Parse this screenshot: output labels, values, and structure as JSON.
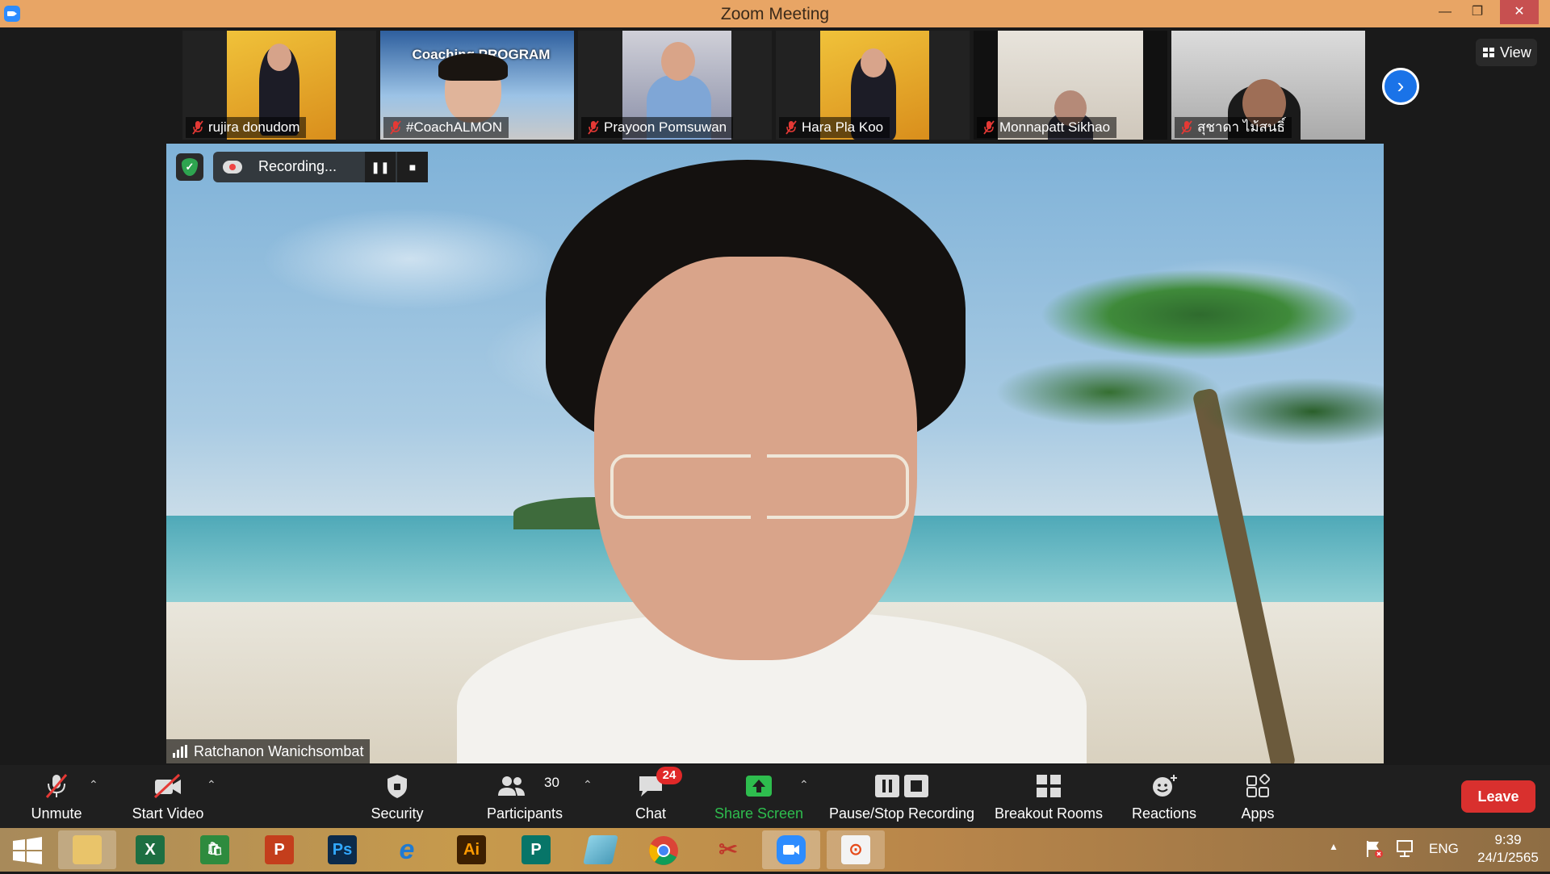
{
  "window": {
    "title": "Zoom Meeting",
    "minimize": "—",
    "maximize": "❐",
    "close": "✕"
  },
  "gallery": {
    "participants": [
      {
        "name": "rujira donudom"
      },
      {
        "name": "#CoachALMON",
        "overlay": "Coaching PROGRAM"
      },
      {
        "name": "Prayoon Pomsuwan"
      },
      {
        "name": "Hara Pla Koo"
      },
      {
        "name": "Monnapatt Sikhao"
      },
      {
        "name": "สุชาดา ไม้สนธิ์"
      }
    ],
    "next_arrow": "›",
    "view_label": "View"
  },
  "recording": {
    "status": "Recording...",
    "pause": "❚❚",
    "stop": "■"
  },
  "active_speaker": {
    "name": "Ratchanon Wanichsombat"
  },
  "toolbar": {
    "unmute": "Unmute",
    "start_video": "Start Video",
    "security": "Security",
    "participants": "Participants",
    "participants_count": "30",
    "chat": "Chat",
    "chat_badge": "24",
    "share_screen": "Share Screen",
    "pause_stop_recording": "Pause/Stop Recording",
    "breakout_rooms": "Breakout Rooms",
    "reactions": "Reactions",
    "apps": "Apps",
    "leave": "Leave",
    "caret": "⌃"
  },
  "taskbar": {
    "apps": [
      {
        "name": "excel",
        "glyph": "X",
        "color": "#1d6f42"
      },
      {
        "name": "store",
        "glyph": "🛍",
        "color": "#2e8b3e"
      },
      {
        "name": "powerpoint",
        "glyph": "P",
        "color": "#c43e1c"
      },
      {
        "name": "photoshop",
        "glyph": "Ps",
        "color": "#0b2a4a"
      },
      {
        "name": "internet-explorer",
        "glyph": "e",
        "color": "#1f7ad1"
      },
      {
        "name": "illustrator",
        "glyph": "Ai",
        "color": "#3d1f00"
      },
      {
        "name": "publisher",
        "glyph": "P",
        "color": "#077568"
      }
    ],
    "language": "ENG",
    "time": "9:39",
    "date": "24/1/2565"
  },
  "colors": {
    "titlebar": "#e8a565",
    "accent_blue": "#1a73e8",
    "share_green": "#2ebd4e",
    "leave_red": "#d9302e",
    "recording_shield": "#2ea44f"
  }
}
